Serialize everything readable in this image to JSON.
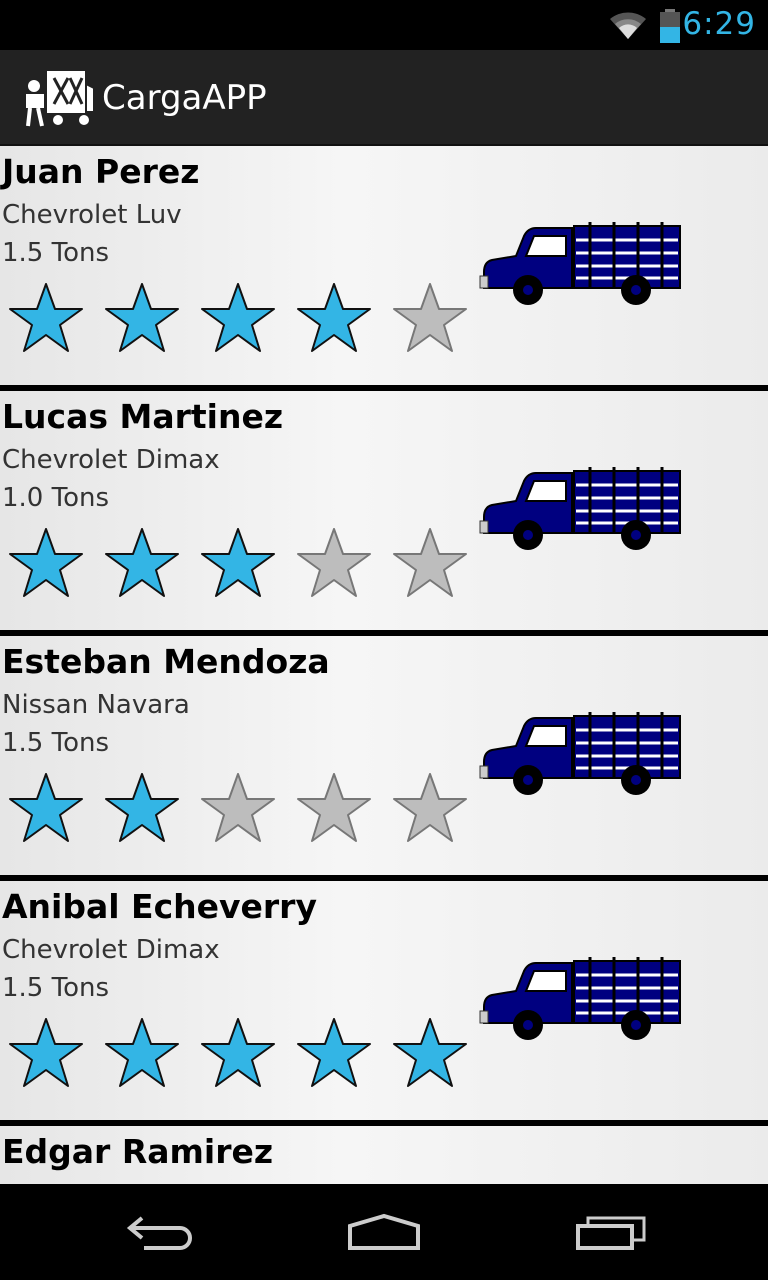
{
  "status_bar": {
    "time": "6:29",
    "wifi_icon": "wifi-icon",
    "battery_icon": "battery-icon"
  },
  "app_bar": {
    "title": "CargaAPP",
    "logo_icon": "moving-truck-logo-icon"
  },
  "colors": {
    "star_filled": "#33b5e5",
    "star_empty": "#bdbdbd",
    "truck": "#000080",
    "clock": "#33b5e5"
  },
  "drivers": [
    {
      "name": "Juan Perez",
      "vehicle": "Chevrolet Luv",
      "capacity": "1.5 Tons",
      "rating": 4,
      "max_rating": 5
    },
    {
      "name": "Lucas Martinez",
      "vehicle": "Chevrolet Dimax",
      "capacity": "1.0 Tons",
      "rating": 3,
      "max_rating": 5
    },
    {
      "name": "Esteban Mendoza",
      "vehicle": "Nissan Navara",
      "capacity": "1.5 Tons",
      "rating": 2,
      "max_rating": 5
    },
    {
      "name": "Anibal Echeverry",
      "vehicle": "Chevrolet Dimax",
      "capacity": "1.5 Tons",
      "rating": 5,
      "max_rating": 5
    },
    {
      "name": "Edgar Ramirez"
    }
  ],
  "nav_bar": {
    "back_icon": "back-icon",
    "home_icon": "home-icon",
    "recents_icon": "recent-apps-icon"
  }
}
